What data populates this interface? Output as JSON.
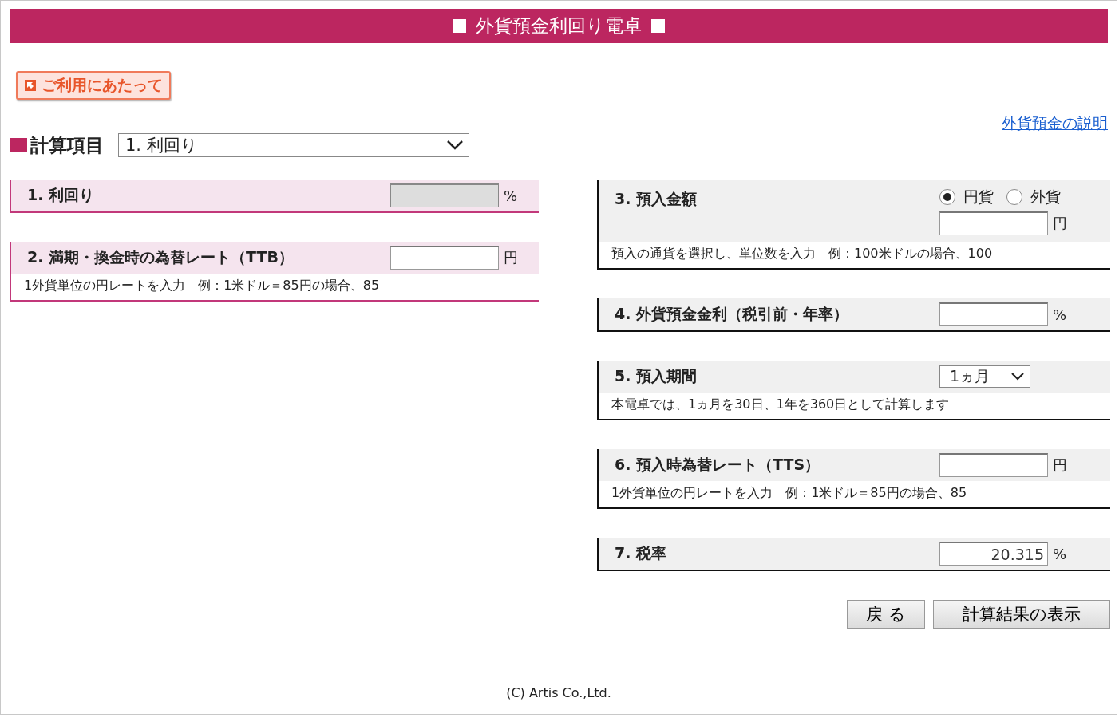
{
  "title": "外貨預金利回り電卓",
  "guide_button": "ご利用にあたって",
  "help_link": "外貨預金の説明",
  "calc_item": {
    "label": "計算項目",
    "value": "1. 利回り"
  },
  "left_sections": [
    {
      "kind": "input",
      "label": "1. 利回り",
      "unit": "%",
      "disabled": true
    },
    {
      "kind": "input",
      "label": "2. 満期・換金時の為替レート（TTB）",
      "unit": "円",
      "disabled": false,
      "note": "1外貨単位の円レートを入力　例：1米ドル＝85円の場合、85"
    }
  ],
  "right_sections": [
    {
      "kind": "radio-input",
      "label": "3. 預入金額",
      "options": [
        {
          "label": "円貨",
          "selected": true
        },
        {
          "label": "外貨",
          "selected": false
        }
      ],
      "unit": "円",
      "disabled": false,
      "note": "預入の通貨を選択し、単位数を入力　例：100米ドルの場合、100"
    },
    {
      "kind": "input",
      "label": "4. 外貨預金金利（税引前・年率）",
      "unit": "%",
      "disabled": false
    },
    {
      "kind": "select",
      "label": "5. 預入期間",
      "value": "1ヵ月",
      "note": "本電卓では、1ヵ月を30日、1年を360日として計算します"
    },
    {
      "kind": "input",
      "label": "6. 預入時為替レート（TTS）",
      "unit": "円",
      "disabled": false,
      "note": "1外貨単位の円レートを入力　例：1米ドル＝85円の場合、85"
    },
    {
      "kind": "input",
      "label": "7. 税率",
      "value": "20.315",
      "unit": "%",
      "disabled": false
    }
  ],
  "buttons": [
    "戻 る",
    "計算結果の表示"
  ],
  "footer": "(C) Artis Co.,Ltd."
}
